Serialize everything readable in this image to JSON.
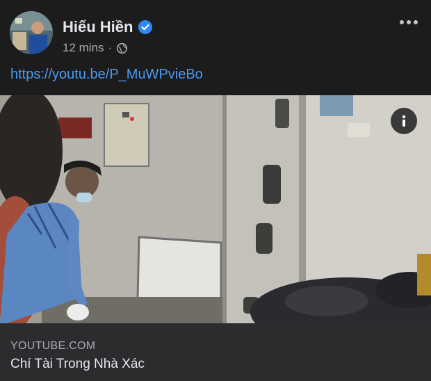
{
  "post": {
    "author": "Hiếu Hiền",
    "timestamp": "12 mins",
    "separator": "·",
    "privacy_icon": "globe-icon",
    "verified_icon": "verified-badge-icon",
    "more_icon": "more-options-icon",
    "link_text": "https://youtu.be/P_MuWPvieBo"
  },
  "preview": {
    "domain": "YOUTUBE.COM",
    "title": "Chí Tài Trong Nhà Xác",
    "info_icon": "info-icon"
  },
  "colors": {
    "background": "#1c1c1d",
    "link": "#4b9bf0",
    "verified": "#2d88ff",
    "footer": "#2c2c2e"
  }
}
